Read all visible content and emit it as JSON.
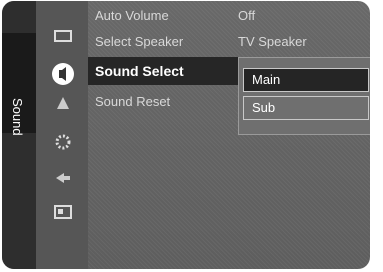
{
  "osd": {
    "tab_label": "Sound",
    "icons": [
      "picture-icon",
      "sound-icon",
      "channel-icon",
      "setup-icon",
      "input-icon",
      "application-icon"
    ],
    "menu_items": [
      {
        "label": "Auto Volume",
        "value": "Off"
      },
      {
        "label": "Select Speaker",
        "value": "TV Speaker"
      },
      {
        "label": "Sound Select",
        "value": ":"
      },
      {
        "label": "Sound Reset",
        "value": ""
      }
    ],
    "dropdown_options": [
      "Main",
      "Sub"
    ],
    "selected_option": "Main",
    "colors": {
      "background": "#666666",
      "highlight": "#262626",
      "text": "#ffffff"
    }
  }
}
